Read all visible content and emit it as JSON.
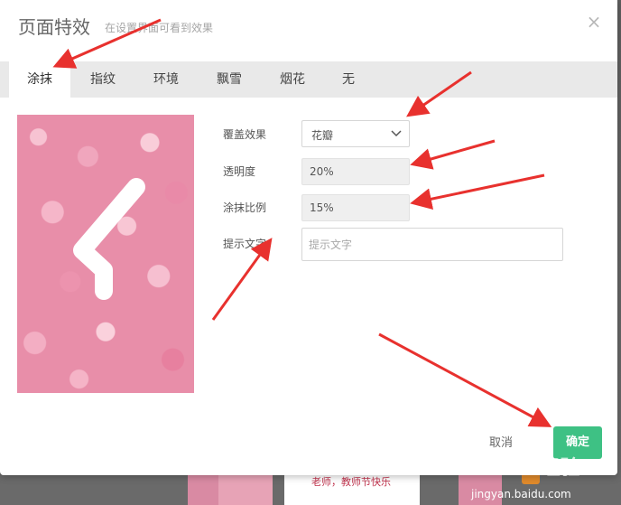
{
  "dialog": {
    "title": "页面特效",
    "subtitle": "在设置界面可看到效果",
    "close_symbol": "×"
  },
  "tabs": [
    {
      "label": "涂抹",
      "active": true
    },
    {
      "label": "指纹",
      "active": false
    },
    {
      "label": "环境",
      "active": false
    },
    {
      "label": "飘雪",
      "active": false
    },
    {
      "label": "烟花",
      "active": false
    },
    {
      "label": "无",
      "active": false
    }
  ],
  "form": {
    "cover_effect": {
      "label": "覆盖效果",
      "value": "花瓣"
    },
    "opacity": {
      "label": "透明度",
      "value": "20%"
    },
    "scratch_ratio": {
      "label": "涂抹比例",
      "value": "15%"
    },
    "hint_text": {
      "label": "提示文字",
      "placeholder": "提示文字"
    }
  },
  "footer": {
    "cancel_label": "取消",
    "confirm_label": "确定"
  },
  "background": {
    "card_text": "老师，教师节快乐"
  },
  "watermark": {
    "logo_text": "Baidu经验",
    "url": "jingyan.baidu.com"
  },
  "colors": {
    "confirm_button": "#3ec184",
    "annotation_arrow": "#e8312e",
    "tab_bar": "#e9e9e9"
  },
  "icons": {
    "close": "close-icon",
    "dropdown": "chevron-down-icon"
  }
}
